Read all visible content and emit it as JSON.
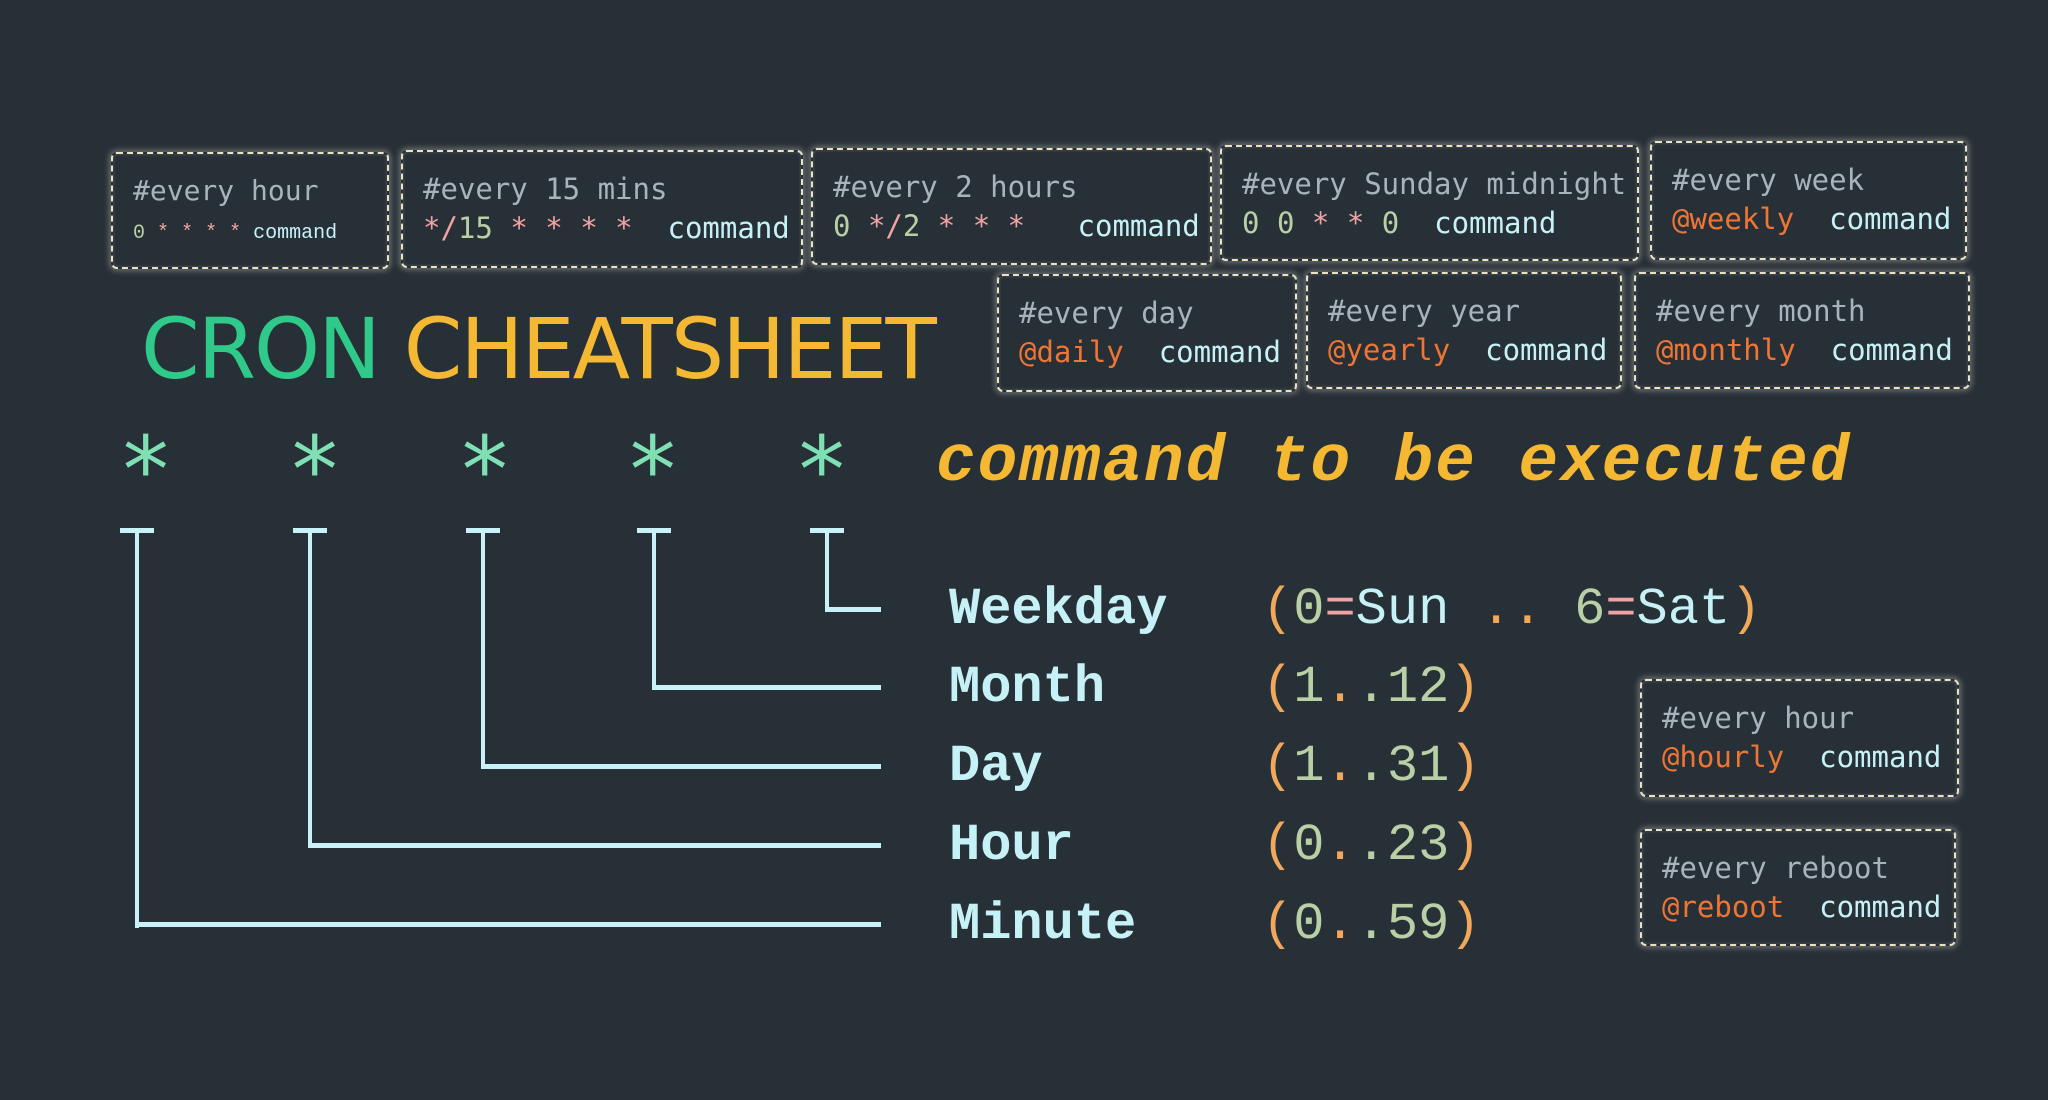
{
  "title": {
    "part1": "CRON",
    "part2": "CHEATSHEET",
    "color1": "#2fc98a",
    "color2": "#f5b833"
  },
  "syntax": {
    "fields": [
      "*",
      "*",
      "*",
      "*",
      "*"
    ],
    "command": "command to be executed"
  },
  "field_descriptions": [
    {
      "name": "Weekday",
      "range": {
        "open": "(",
        "start": "0",
        "start_eq": "=",
        "start_name": "Sun",
        "sep": " .. ",
        "end": "6",
        "end_eq": "=",
        "end_name": "Sat",
        "close": ")"
      }
    },
    {
      "name": "Month",
      "range": {
        "open": "(",
        "start": "1",
        "dot1": ".",
        "dot2": ".",
        "end": "12",
        "close": ")"
      }
    },
    {
      "name": "Day",
      "range": {
        "open": "(",
        "start": "1",
        "dot1": ".",
        "dot2": ".",
        "end": "31",
        "close": ")"
      }
    },
    {
      "name": "Hour",
      "range": {
        "open": "(",
        "start": "0",
        "dot1": ".",
        "dot2": ".",
        "end": "23",
        "close": ")"
      }
    },
    {
      "name": "Minute",
      "range": {
        "open": "(",
        "start": "0",
        "dot1": ".",
        "dot2": ".",
        "end": "59",
        "close": ")"
      }
    }
  ],
  "examples": [
    {
      "comment": "#every hour",
      "tokens": [
        {
          "t": "0",
          "k": "num"
        },
        {
          "t": " ",
          "k": "sp"
        },
        {
          "t": "*",
          "k": "star"
        },
        {
          "t": " ",
          "k": "sp"
        },
        {
          "t": "*",
          "k": "star"
        },
        {
          "t": " ",
          "k": "sp"
        },
        {
          "t": "*",
          "k": "star"
        },
        {
          "t": " ",
          "k": "sp"
        },
        {
          "t": "*",
          "k": "star"
        },
        {
          "t": " ",
          "k": "sp"
        },
        {
          "t": "command",
          "k": "cmd"
        }
      ]
    },
    {
      "comment": "#every 15 mins",
      "tokens": [
        {
          "t": "*/",
          "k": "star"
        },
        {
          "t": "15",
          "k": "num"
        },
        {
          "t": " ",
          "k": "sp"
        },
        {
          "t": "*",
          "k": "star"
        },
        {
          "t": " ",
          "k": "sp"
        },
        {
          "t": "*",
          "k": "star"
        },
        {
          "t": " ",
          "k": "sp"
        },
        {
          "t": "*",
          "k": "star"
        },
        {
          "t": " ",
          "k": "sp"
        },
        {
          "t": "*",
          "k": "star"
        },
        {
          "t": "  ",
          "k": "sp"
        },
        {
          "t": "command",
          "k": "cmd"
        }
      ]
    },
    {
      "comment": "#every 2 hours",
      "tokens": [
        {
          "t": "0",
          "k": "num"
        },
        {
          "t": " ",
          "k": "sp"
        },
        {
          "t": "*/",
          "k": "star"
        },
        {
          "t": "2",
          "k": "num"
        },
        {
          "t": " ",
          "k": "sp"
        },
        {
          "t": "*",
          "k": "star"
        },
        {
          "t": " ",
          "k": "sp"
        },
        {
          "t": "*",
          "k": "star"
        },
        {
          "t": " ",
          "k": "sp"
        },
        {
          "t": "*",
          "k": "star"
        },
        {
          "t": "   ",
          "k": "sp"
        },
        {
          "t": "command",
          "k": "cmd"
        }
      ]
    },
    {
      "comment": "#every Sunday midnight",
      "tokens": [
        {
          "t": "0",
          "k": "num"
        },
        {
          "t": " ",
          "k": "sp"
        },
        {
          "t": "0",
          "k": "num"
        },
        {
          "t": " ",
          "k": "sp"
        },
        {
          "t": "*",
          "k": "star"
        },
        {
          "t": " ",
          "k": "sp"
        },
        {
          "t": "*",
          "k": "star"
        },
        {
          "t": " ",
          "k": "sp"
        },
        {
          "t": "0",
          "k": "num"
        },
        {
          "t": "  ",
          "k": "sp"
        },
        {
          "t": "command",
          "k": "cmd"
        }
      ]
    },
    {
      "comment": "#every week",
      "tokens": [
        {
          "t": "@weekly",
          "k": "at"
        },
        {
          "t": "  ",
          "k": "sp"
        },
        {
          "t": "command",
          "k": "cmd"
        }
      ]
    },
    {
      "comment": "#every day",
      "tokens": [
        {
          "t": "@daily",
          "k": "at"
        },
        {
          "t": "  ",
          "k": "sp"
        },
        {
          "t": "command",
          "k": "cmd"
        }
      ]
    },
    {
      "comment": "#every year",
      "tokens": [
        {
          "t": "@yearly",
          "k": "at"
        },
        {
          "t": "  ",
          "k": "sp"
        },
        {
          "t": "command",
          "k": "cmd"
        }
      ]
    },
    {
      "comment": "#every month",
      "tokens": [
        {
          "t": "@monthly",
          "k": "at"
        },
        {
          "t": "  ",
          "k": "sp"
        },
        {
          "t": "command",
          "k": "cmd"
        }
      ]
    },
    {
      "comment": "#every hour",
      "tokens": [
        {
          "t": "@hourly",
          "k": "at"
        },
        {
          "t": "  ",
          "k": "sp"
        },
        {
          "t": "command",
          "k": "cmd"
        }
      ]
    },
    {
      "comment": "#every reboot",
      "tokens": [
        {
          "t": "@reboot",
          "k": "at"
        },
        {
          "t": "  ",
          "k": "sp"
        },
        {
          "t": "command",
          "k": "cmd"
        }
      ]
    }
  ],
  "colors": {
    "background": "#283037",
    "comment": "#a9b3bd",
    "number": "#b9cfa6",
    "star": "#f0a3a3",
    "command": "#c6f1f6",
    "at_keyword": "#ee7533",
    "field_star": "#7ee0b3",
    "tree_line": "#c9f1f8",
    "range_paren": "#f2a85a"
  }
}
